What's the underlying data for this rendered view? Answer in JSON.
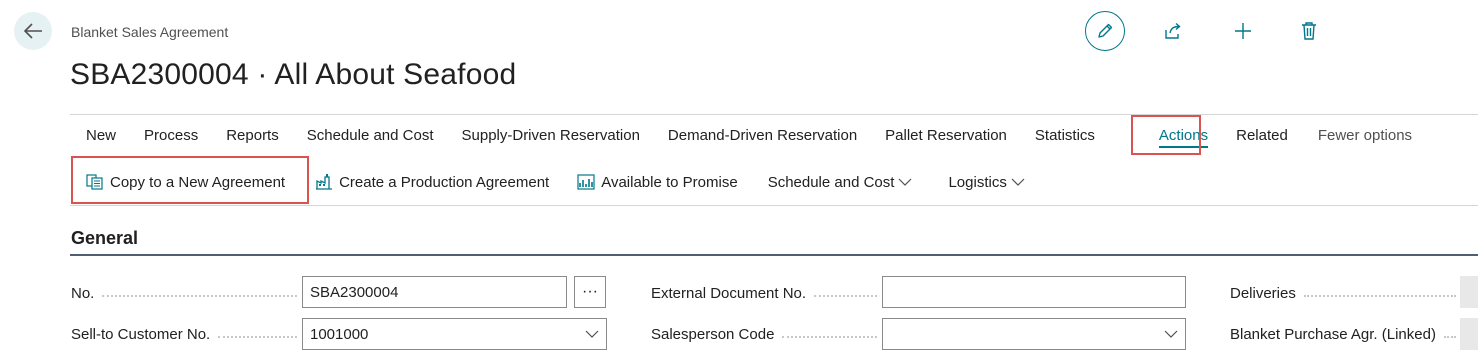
{
  "header": {
    "breadcrumb": "Blanket Sales Agreement",
    "title": "SBA2300004 · All About Seafood"
  },
  "tabs": [
    {
      "label": "New"
    },
    {
      "label": "Process"
    },
    {
      "label": "Reports"
    },
    {
      "label": "Schedule and Cost"
    },
    {
      "label": "Supply-Driven Reservation"
    },
    {
      "label": "Demand-Driven Reservation"
    },
    {
      "label": "Pallet Reservation"
    },
    {
      "label": "Statistics"
    },
    {
      "label": "Actions"
    },
    {
      "label": "Related"
    },
    {
      "label": "Fewer options"
    }
  ],
  "actions": {
    "copy": "Copy to a New Agreement",
    "create_production": "Create a Production Agreement",
    "available": "Available to Promise",
    "schedule": "Schedule and Cost",
    "logistics": "Logistics"
  },
  "general": {
    "title": "General",
    "no_label": "No.",
    "no_value": "SBA2300004",
    "assist_label": "···",
    "customer_label": "Sell-to Customer No.",
    "customer_value": "1001000",
    "ext_doc_label": "External Document No.",
    "ext_doc_value": "",
    "salesperson_label": "Salesperson Code",
    "salesperson_value": "",
    "deliveries_label": "Deliveries",
    "blanket_purchase_label": "Blanket Purchase Agr. (Linked)"
  },
  "colors": {
    "accent": "#00778b",
    "highlight": "#d9534f"
  },
  "icons": [
    "back-arrow-icon",
    "edit-pencil-icon",
    "share-icon",
    "plus-icon",
    "trash-icon",
    "copy-document-icon",
    "production-icon",
    "chart-icon",
    "chevron-down-icon"
  ]
}
